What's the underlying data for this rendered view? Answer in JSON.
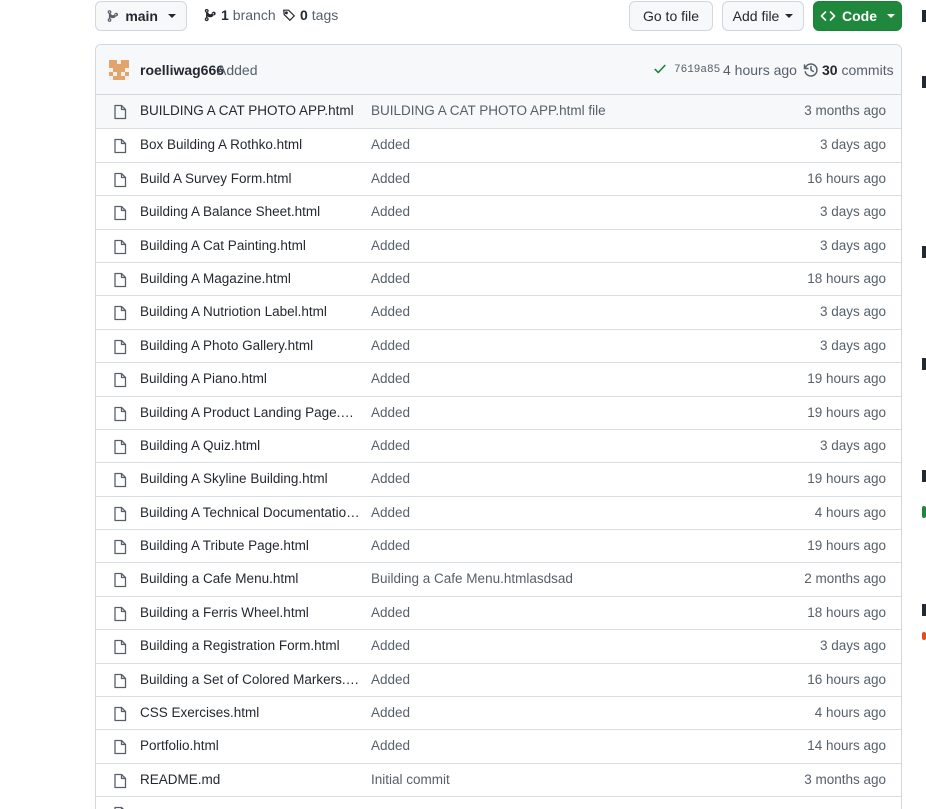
{
  "toolbar": {
    "branch": "main",
    "branch_count": "1",
    "branch_label": "branch",
    "tag_count": "0",
    "tag_label": "tags",
    "go_to_file": "Go to file",
    "add_file": "Add file",
    "code": "Code"
  },
  "latest_commit": {
    "author": "roelliwag666",
    "message": "Added",
    "sha": "7619a85",
    "age": "4 hours ago",
    "commit_count": "30",
    "commits_label": "commits"
  },
  "files": [
    {
      "name": "BUILDING A CAT PHOTO APP.html",
      "commit": "BUILDING A CAT PHOTO APP.html file",
      "age": "3 months ago"
    },
    {
      "name": "Box Building A Rothko.html",
      "commit": "Added",
      "age": "3 days ago"
    },
    {
      "name": "Build A Survey Form.html",
      "commit": "Added",
      "age": "16 hours ago"
    },
    {
      "name": "Building A Balance Sheet.html",
      "commit": "Added",
      "age": "3 days ago"
    },
    {
      "name": "Building A Cat Painting.html",
      "commit": "Added",
      "age": "3 days ago"
    },
    {
      "name": "Building A Magazine.html",
      "commit": "Added",
      "age": "18 hours ago"
    },
    {
      "name": "Building A Nutriotion Label.html",
      "commit": "Added",
      "age": "3 days ago"
    },
    {
      "name": "Building A Photo Gallery.html",
      "commit": "Added",
      "age": "3 days ago"
    },
    {
      "name": "Building A Piano.html",
      "commit": "Added",
      "age": "19 hours ago"
    },
    {
      "name": "Building A Product Landing Page.html",
      "commit": "Added",
      "age": "19 hours ago"
    },
    {
      "name": "Building A Quiz.html",
      "commit": "Added",
      "age": "3 days ago"
    },
    {
      "name": "Building A Skyline Building.html",
      "commit": "Added",
      "age": "19 hours ago"
    },
    {
      "name": "Building A Technical Documentation....",
      "commit": "Added",
      "age": "4 hours ago"
    },
    {
      "name": "Building A Tribute Page.html",
      "commit": "Added",
      "age": "19 hours ago"
    },
    {
      "name": "Building a Cafe Menu.html",
      "commit": "Building a Cafe Menu.htmlasdsad",
      "age": "2 months ago"
    },
    {
      "name": "Building a Ferris Wheel.html",
      "commit": "Added",
      "age": "18 hours ago"
    },
    {
      "name": "Building a Registration Form.html",
      "commit": "Added",
      "age": "3 days ago"
    },
    {
      "name": "Building a Set of Colored Markers.html",
      "commit": "Added",
      "age": "16 hours ago"
    },
    {
      "name": "CSS Exercises.html",
      "commit": "Added",
      "age": "4 hours ago"
    },
    {
      "name": "Portfolio.html",
      "commit": "Added",
      "age": "14 hours ago"
    },
    {
      "name": "README.md",
      "commit": "Initial commit",
      "age": "3 months ago"
    },
    {
      "name": "",
      "commit": "",
      "age": ""
    }
  ],
  "colors": {
    "code_button": "#1f883d",
    "check": "#1a7f37",
    "border": "#d0d7de",
    "muted_text": "#57606a"
  },
  "icons": [
    "git-branch-icon",
    "tag-icon",
    "caret-down-icon",
    "code-icon",
    "check-icon",
    "history-icon",
    "file-icon",
    "avatar-identicon"
  ]
}
